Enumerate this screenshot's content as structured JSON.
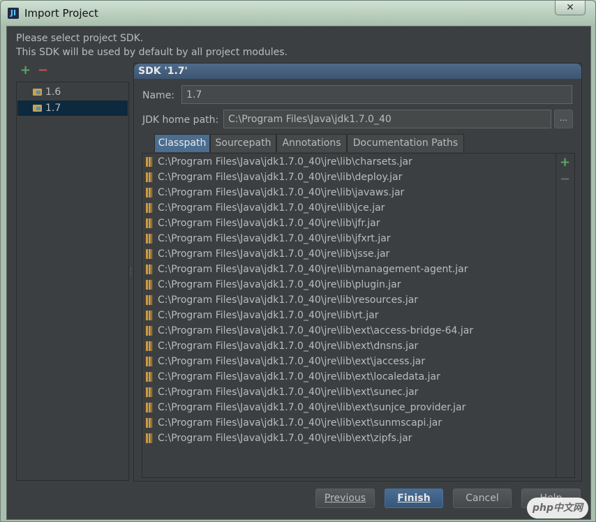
{
  "window": {
    "title": "Import Project",
    "app_icon_text": "JI"
  },
  "description": [
    "Please select project SDK.",
    "This SDK will be used by default by all project modules."
  ],
  "sdk_list": {
    "items": [
      {
        "label": "1.6",
        "selected": false
      },
      {
        "label": "1.7",
        "selected": true
      }
    ]
  },
  "panel": {
    "title": "SDK '1.7'",
    "name_label": "Name:",
    "name_value": "1.7",
    "jdk_home_label": "JDK home path:",
    "jdk_home_value": "C:\\Program Files\\Java\\jdk1.7.0_40",
    "browse_label": "...",
    "tabs": [
      "Classpath",
      "Sourcepath",
      "Annotations",
      "Documentation Paths"
    ],
    "active_tab": "Classpath",
    "paths": [
      "C:\\Program Files\\Java\\jdk1.7.0_40\\jre\\lib\\charsets.jar",
      "C:\\Program Files\\Java\\jdk1.7.0_40\\jre\\lib\\deploy.jar",
      "C:\\Program Files\\Java\\jdk1.7.0_40\\jre\\lib\\javaws.jar",
      "C:\\Program Files\\Java\\jdk1.7.0_40\\jre\\lib\\jce.jar",
      "C:\\Program Files\\Java\\jdk1.7.0_40\\jre\\lib\\jfr.jar",
      "C:\\Program Files\\Java\\jdk1.7.0_40\\jre\\lib\\jfxrt.jar",
      "C:\\Program Files\\Java\\jdk1.7.0_40\\jre\\lib\\jsse.jar",
      "C:\\Program Files\\Java\\jdk1.7.0_40\\jre\\lib\\management-agent.jar",
      "C:\\Program Files\\Java\\jdk1.7.0_40\\jre\\lib\\plugin.jar",
      "C:\\Program Files\\Java\\jdk1.7.0_40\\jre\\lib\\resources.jar",
      "C:\\Program Files\\Java\\jdk1.7.0_40\\jre\\lib\\rt.jar",
      "C:\\Program Files\\Java\\jdk1.7.0_40\\jre\\lib\\ext\\access-bridge-64.jar",
      "C:\\Program Files\\Java\\jdk1.7.0_40\\jre\\lib\\ext\\dnsns.jar",
      "C:\\Program Files\\Java\\jdk1.7.0_40\\jre\\lib\\ext\\jaccess.jar",
      "C:\\Program Files\\Java\\jdk1.7.0_40\\jre\\lib\\ext\\localedata.jar",
      "C:\\Program Files\\Java\\jdk1.7.0_40\\jre\\lib\\ext\\sunec.jar",
      "C:\\Program Files\\Java\\jdk1.7.0_40\\jre\\lib\\ext\\sunjce_provider.jar",
      "C:\\Program Files\\Java\\jdk1.7.0_40\\jre\\lib\\ext\\sunmscapi.jar",
      "C:\\Program Files\\Java\\jdk1.7.0_40\\jre\\lib\\ext\\zipfs.jar"
    ]
  },
  "buttons": {
    "previous": "Previous",
    "finish": "Finish",
    "cancel": "Cancel",
    "help": "Help"
  },
  "watermark": "php中文网",
  "colors": {
    "background": "#3c3f41",
    "selection": "#0d293e",
    "accent": "#4b6d8f",
    "add_green": "#59a869",
    "remove_red": "#c75450",
    "jar_icon": "#d19a3a"
  }
}
